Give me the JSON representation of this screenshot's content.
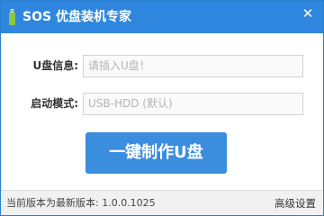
{
  "window": {
    "title": "SOS 优盘装机专家",
    "close_glyph": "✕"
  },
  "form": {
    "usb_info_label": "U盘信息:",
    "usb_info_value": "请插入U盘！",
    "boot_mode_label": "启动模式:",
    "boot_mode_value": "USB-HDD (默认)"
  },
  "actions": {
    "create_label": "一键制作U盘"
  },
  "status": {
    "version_text": "当前版本为最新版本: 1.0.0.1025",
    "settings_label": "高级设置"
  },
  "colors": {
    "titlebar": "#2e86de",
    "button": "#3b8ddd",
    "app_icon": "#8dc63f"
  }
}
